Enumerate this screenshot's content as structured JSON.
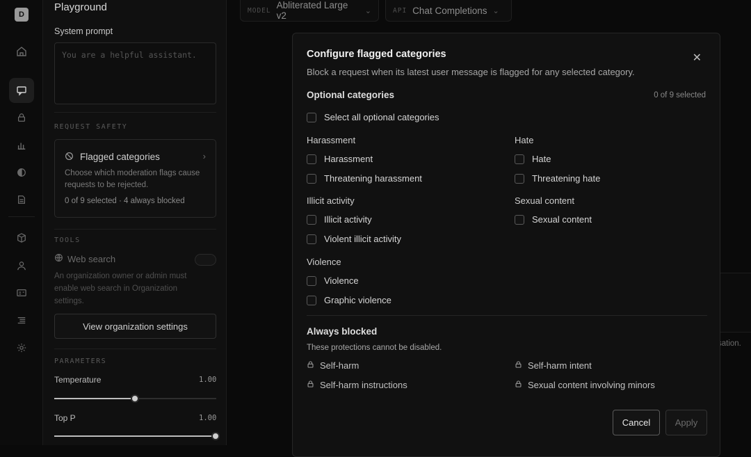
{
  "rail": {
    "logo": "D"
  },
  "sidebar": {
    "title": "Playground",
    "system_prompt_label": "System prompt",
    "system_prompt_placeholder": "You are a helpful assistant.",
    "request_safety_heading": "REQUEST SAFETY",
    "flagged": {
      "title": "Flagged categories",
      "description": "Choose which moderation flags cause requests to be rejected.",
      "status": "0 of 9 selected · 4 always blocked"
    },
    "tools_heading": "TOOLS",
    "web_search_label": "Web search",
    "web_search_note": "An organization owner or admin must enable web search in Organization settings.",
    "view_org_button": "View organization settings",
    "parameters_heading": "PARAMETERS",
    "temperature": {
      "label": "Temperature",
      "value": "1.00",
      "level": 0.5
    },
    "top_p": {
      "label": "Top P",
      "value": "1.00",
      "level": 1.0
    }
  },
  "topbar": {
    "model_key": "MODEL",
    "model_value": "Abliterated Large v2",
    "api_key": "API",
    "api_value": "Chat Completions"
  },
  "background_text": "sation.",
  "modal": {
    "title": "Configure flagged categories",
    "subtitle": "Block a request when its latest user message is flagged for any selected category.",
    "optional_heading": "Optional categories",
    "selected_count": "0 of 9 selected",
    "select_all": "Select all optional categories",
    "groups": {
      "harassment": {
        "label": "Harassment",
        "items": [
          "Harassment",
          "Threatening harassment"
        ]
      },
      "hate": {
        "label": "Hate",
        "items": [
          "Hate",
          "Threatening hate"
        ]
      },
      "illicit": {
        "label": "Illicit activity",
        "items": [
          "Illicit activity",
          "Violent illicit activity"
        ]
      },
      "sexual": {
        "label": "Sexual content",
        "items": [
          "Sexual content"
        ]
      },
      "violence": {
        "label": "Violence",
        "items": [
          "Violence",
          "Graphic violence"
        ]
      }
    },
    "always_blocked_heading": "Always blocked",
    "always_blocked_note": "These protections cannot be disabled.",
    "always_blocked": [
      "Self-harm",
      "Self-harm intent",
      "Self-harm instructions",
      "Sexual content involving minors"
    ],
    "cancel_label": "Cancel",
    "apply_label": "Apply"
  }
}
